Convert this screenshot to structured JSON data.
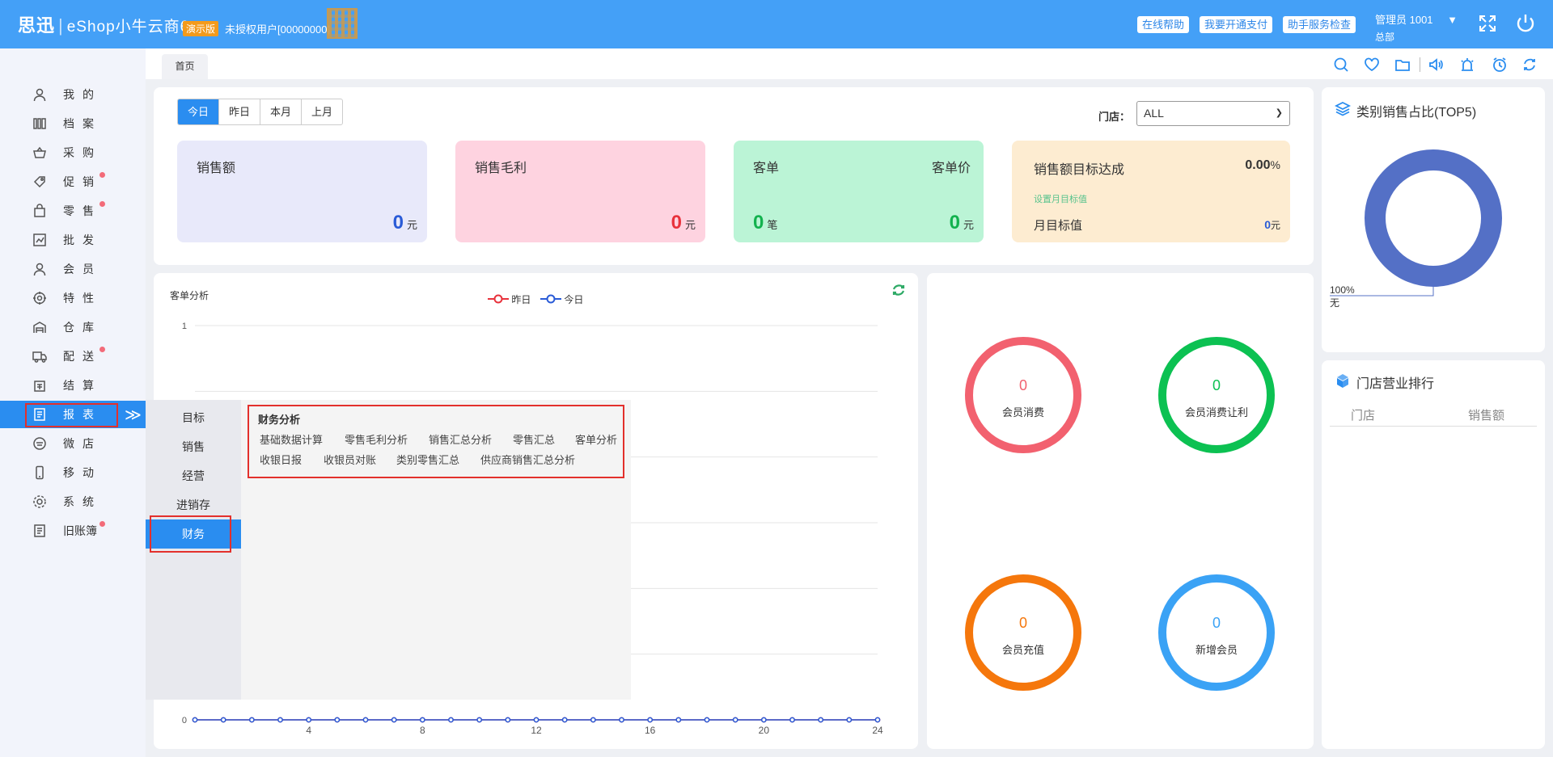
{
  "header": {
    "brand": "思迅",
    "product": "eShop小牛云商6",
    "demo_badge": "演示版",
    "license": "未授权用户[00000000]",
    "buttons": [
      "在线帮助",
      "我要开通支付",
      "助手服务检查"
    ],
    "admin": "管理员 1001",
    "admin_caret": "▼",
    "branch": "总部",
    "colors": {
      "bar": "#44a0f7",
      "accent": "#2a8df0"
    }
  },
  "sidebar": {
    "items": [
      {
        "label": "我的",
        "icon": "user-icon",
        "dot": false
      },
      {
        "label": "档案",
        "icon": "archive-icon",
        "dot": false
      },
      {
        "label": "采购",
        "icon": "basket-icon",
        "dot": false
      },
      {
        "label": "促销",
        "icon": "tag-icon",
        "dot": true
      },
      {
        "label": "零售",
        "icon": "bag-icon",
        "dot": true
      },
      {
        "label": "批发",
        "icon": "chart-icon",
        "dot": false
      },
      {
        "label": "会员",
        "icon": "member-icon",
        "dot": false
      },
      {
        "label": "特性",
        "icon": "target-icon",
        "dot": false
      },
      {
        "label": "仓库",
        "icon": "warehouse-icon",
        "dot": false
      },
      {
        "label": "配送",
        "icon": "truck-icon",
        "dot": true
      },
      {
        "label": "结算",
        "icon": "settle-icon",
        "dot": false
      },
      {
        "label": "报表",
        "icon": "report-icon",
        "dot": false,
        "active": true
      },
      {
        "label": "微店",
        "icon": "shop-icon",
        "dot": false
      },
      {
        "label": "移动",
        "icon": "mobile-icon",
        "dot": false
      },
      {
        "label": "系统",
        "icon": "gear-icon",
        "dot": false
      },
      {
        "label": "旧账簿",
        "icon": "ledger-icon",
        "dot": true
      }
    ],
    "expand_glyph": "≫"
  },
  "tabs": {
    "home": "首页"
  },
  "summary": {
    "periods": [
      "今日",
      "昨日",
      "本月",
      "上月"
    ],
    "active_period": "今日",
    "store_label": "门店：",
    "store_value": "ALL",
    "cards": {
      "sales": {
        "title": "销售额",
        "value": "0",
        "unit": "元"
      },
      "gross": {
        "title": "销售毛利",
        "value": "0",
        "unit": "元"
      },
      "orders": {
        "title": "客单",
        "value": "0",
        "unit": "笔",
        "title2": "客单价",
        "value2": "0",
        "unit2": "元"
      },
      "target": {
        "title": "销售额目标达成",
        "pct": "0.00",
        "pct_unit": "%",
        "set_link": "设置月目标值",
        "month_label": "月目标值",
        "month_value": "0",
        "month_unit": "元"
      }
    }
  },
  "chart_data": {
    "type": "line",
    "title": "客单分析",
    "x": [
      0,
      1,
      2,
      3,
      4,
      5,
      6,
      7,
      8,
      9,
      10,
      11,
      12,
      13,
      14,
      15,
      16,
      17,
      18,
      19,
      20,
      21,
      22,
      23,
      24
    ],
    "xticks": [
      4,
      8,
      12,
      16,
      20,
      24
    ],
    "ylim": [
      0,
      1
    ],
    "yticks": [
      0,
      1
    ],
    "grid": true,
    "legend_position": "top-center",
    "series": [
      {
        "name": "昨日",
        "color": "#e8323c",
        "values": [
          0,
          0,
          0,
          0,
          0,
          0,
          0,
          0,
          0,
          0,
          0,
          0,
          0,
          0,
          0,
          0,
          0,
          0,
          0,
          0,
          0,
          0,
          0,
          0,
          0
        ]
      },
      {
        "name": "今日",
        "color": "#2a5bd7",
        "values": [
          0,
          0,
          0,
          0,
          0,
          0,
          0,
          0,
          0,
          0,
          0,
          0,
          0,
          0,
          0,
          0,
          0,
          0,
          0,
          0,
          0,
          0,
          0,
          0,
          0
        ]
      }
    ]
  },
  "submenu": {
    "items": [
      "目标",
      "销售",
      "经营",
      "进销存",
      "财务"
    ],
    "active": "财务",
    "finance": {
      "title": "财务分析",
      "links_row1": [
        "基础数据计算",
        "零售毛利分析",
        "销售汇总分析",
        "零售汇总",
        "客单分析"
      ],
      "links_row2": [
        "收银日报",
        "收银员对账",
        "类别零售汇总",
        "供应商销售汇总分析"
      ]
    }
  },
  "members": [
    {
      "value": "0",
      "label": "会员消费",
      "color": "#f2616f"
    },
    {
      "value": "0",
      "label": "会员消费让利",
      "color": "#0cc152"
    },
    {
      "value": "0",
      "label": "会员充值",
      "color": "#f5770c"
    },
    {
      "value": "0",
      "label": "新增会员",
      "color": "#3aa2f5"
    }
  ],
  "category_share": {
    "title": "类别销售占比(TOP5)",
    "slices": [
      {
        "label": "无",
        "percent": 100,
        "percent_label": "100%",
        "color": "#5470c6"
      }
    ]
  },
  "store_rank": {
    "title": "门店营业排行",
    "columns": [
      "门店",
      "销售额"
    ]
  }
}
